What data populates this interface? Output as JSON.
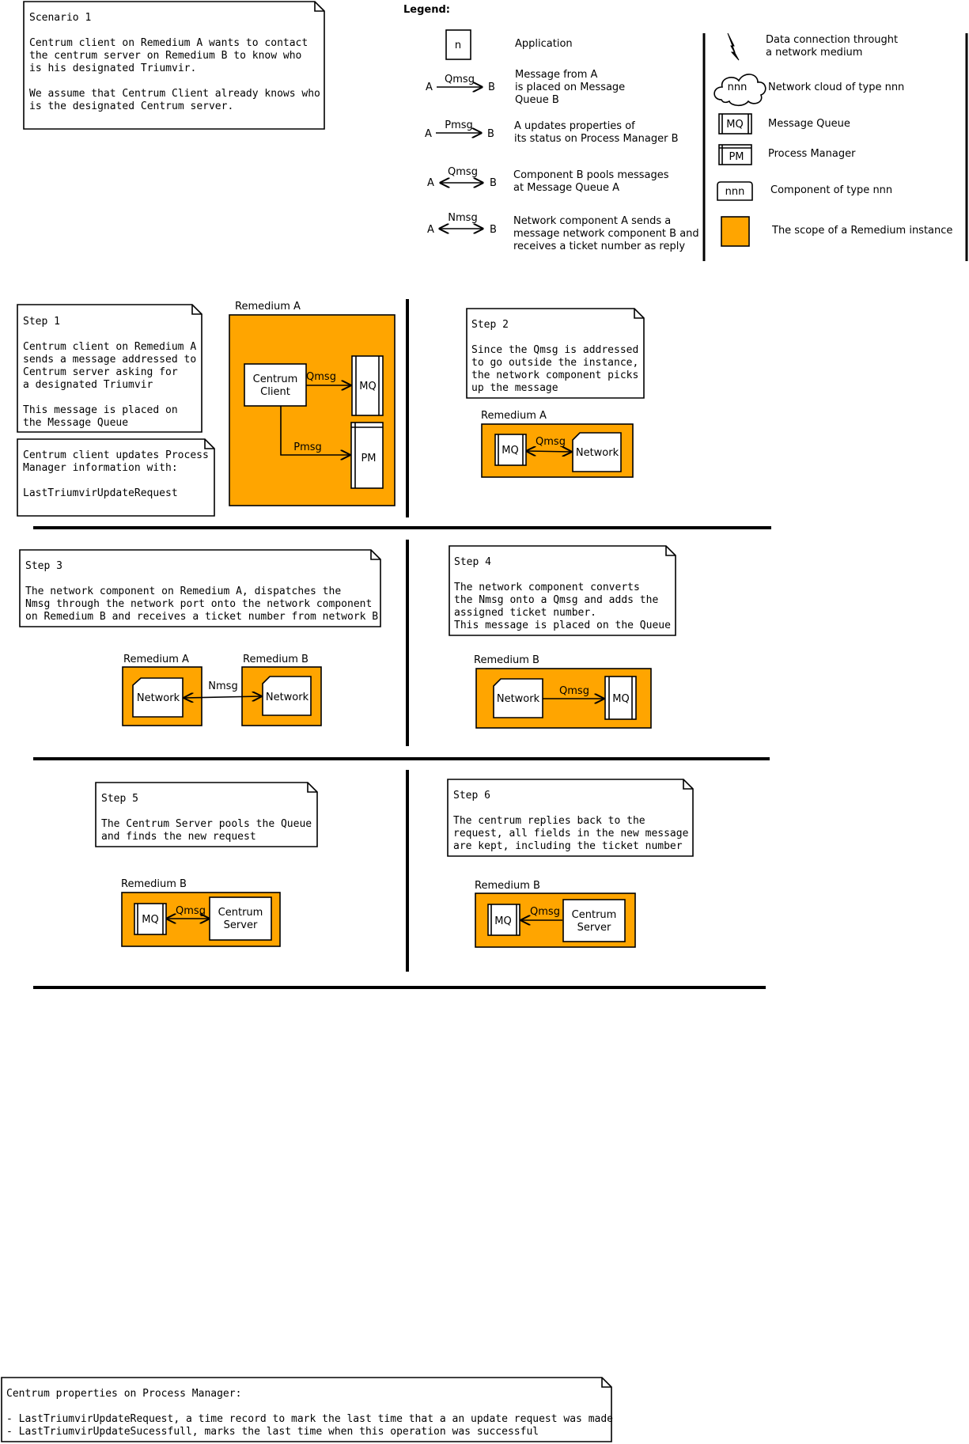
{
  "colors": {
    "remedium_scope": "#FFA500",
    "line": "#000000",
    "background": "#FFFFFF"
  },
  "scenario_note": [
    "Scenario 1",
    "",
    "Centrum client on Remedium A wants to contact",
    "the centrum server on Remedium B to know who",
    "is his designated Triumvir.",
    "",
    "We assume that Centrum Client already knows who",
    "is the designated Centrum server."
  ],
  "legend": {
    "title": "Legend:",
    "application_symbol": "n",
    "application": "Application",
    "end_a": "A",
    "end_b": "B",
    "qmsg_label": "Qmsg",
    "pmsg_label": "Pmsg",
    "nmsg_label": "Nmsg",
    "qmsg_desc": [
      "Message from A",
      "is placed on Message",
      "Queue B"
    ],
    "pmsg_desc": [
      "A updates properties of",
      "its status on Process Manager B"
    ],
    "pool_desc": [
      "Component B pools messages",
      "at Message Queue A"
    ],
    "nmsg_desc": [
      "Network component A sends a",
      "message network component B and",
      "receives a ticket number as reply"
    ],
    "data_connection": [
      "Data connection throught",
      "a network medium"
    ],
    "cloud_symbol": "nnn",
    "network_cloud": "Network cloud of type nnn",
    "mq_symbol": "MQ",
    "message_queue": "Message Queue",
    "pm_symbol": "PM",
    "process_manager": "Process Manager",
    "component_symbol": "nnn",
    "component": "Component of type nnn",
    "scope": "The scope of a Remedium instance"
  },
  "labels": {
    "remedium_a": "Remedium A",
    "remedium_b": "Remedium B",
    "centrum_client": [
      "Centrum",
      "Client"
    ],
    "centrum_server": [
      "Centrum",
      "Server"
    ],
    "mq": "MQ",
    "pm": "PM",
    "network": "Network",
    "qmsg": "Qmsg",
    "pmsg": "Pmsg",
    "nmsg": "Nmsg"
  },
  "steps": {
    "step1": [
      "Step 1",
      "",
      "Centrum client on Remedium A",
      "sends a message addressed to",
      "Centrum server asking for",
      "a designated Triumvir",
      "",
      "This message is placed on",
      "the Message Queue"
    ],
    "step1b": [
      "Centrum client updates Process",
      "Manager information with:",
      "",
      "LastTriumvirUpdateRequest"
    ],
    "step2": [
      "Step 2",
      "",
      "Since the Qmsg is addressed",
      "to go outside the instance,",
      "the network component picks",
      "up the message"
    ],
    "step3": [
      "Step 3",
      "",
      "The network component on Remedium A, dispatches the",
      "Nmsg through the network port onto the network component",
      "on Remedium B and receives a ticket number from network B"
    ],
    "step4": [
      "Step 4",
      "",
      "The network component converts",
      "the Nmsg onto a Qmsg and adds the",
      "assigned ticket number.",
      "This message is placed on the Queue"
    ],
    "step5": [
      "Step 5",
      "",
      "The Centrum Server pools the Queue",
      "and finds the new request"
    ],
    "step6": [
      "Step 6",
      "",
      "The centrum replies back to the",
      "request, all fields in the new message",
      "are kept, including the ticket number"
    ]
  },
  "footer_note": [
    "Centrum properties on Process Manager:",
    "",
    "- LastTriumvirUpdateRequest, a time record to mark the last time that a an update request was made",
    "- LastTriumvirUpdateSucessfull, marks the last time when this operation was successful"
  ]
}
